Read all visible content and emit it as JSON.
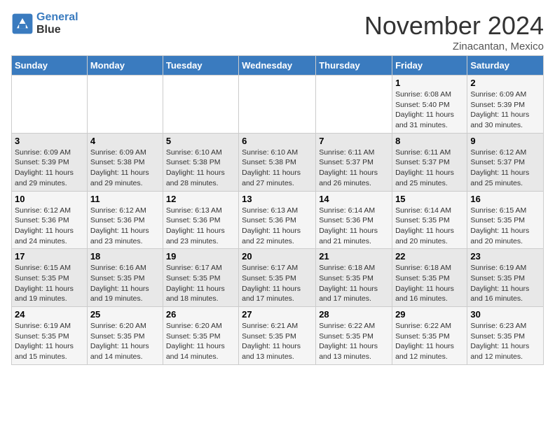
{
  "header": {
    "logo_line1": "General",
    "logo_line2": "Blue",
    "month_title": "November 2024",
    "subtitle": "Zinacantan, Mexico"
  },
  "weekdays": [
    "Sunday",
    "Monday",
    "Tuesday",
    "Wednesday",
    "Thursday",
    "Friday",
    "Saturday"
  ],
  "weeks": [
    [
      {
        "day": "",
        "info": ""
      },
      {
        "day": "",
        "info": ""
      },
      {
        "day": "",
        "info": ""
      },
      {
        "day": "",
        "info": ""
      },
      {
        "day": "",
        "info": ""
      },
      {
        "day": "1",
        "info": "Sunrise: 6:08 AM\nSunset: 5:40 PM\nDaylight: 11 hours and 31 minutes."
      },
      {
        "day": "2",
        "info": "Sunrise: 6:09 AM\nSunset: 5:39 PM\nDaylight: 11 hours and 30 minutes."
      }
    ],
    [
      {
        "day": "3",
        "info": "Sunrise: 6:09 AM\nSunset: 5:39 PM\nDaylight: 11 hours and 29 minutes."
      },
      {
        "day": "4",
        "info": "Sunrise: 6:09 AM\nSunset: 5:38 PM\nDaylight: 11 hours and 29 minutes."
      },
      {
        "day": "5",
        "info": "Sunrise: 6:10 AM\nSunset: 5:38 PM\nDaylight: 11 hours and 28 minutes."
      },
      {
        "day": "6",
        "info": "Sunrise: 6:10 AM\nSunset: 5:38 PM\nDaylight: 11 hours and 27 minutes."
      },
      {
        "day": "7",
        "info": "Sunrise: 6:11 AM\nSunset: 5:37 PM\nDaylight: 11 hours and 26 minutes."
      },
      {
        "day": "8",
        "info": "Sunrise: 6:11 AM\nSunset: 5:37 PM\nDaylight: 11 hours and 25 minutes."
      },
      {
        "day": "9",
        "info": "Sunrise: 6:12 AM\nSunset: 5:37 PM\nDaylight: 11 hours and 25 minutes."
      }
    ],
    [
      {
        "day": "10",
        "info": "Sunrise: 6:12 AM\nSunset: 5:36 PM\nDaylight: 11 hours and 24 minutes."
      },
      {
        "day": "11",
        "info": "Sunrise: 6:12 AM\nSunset: 5:36 PM\nDaylight: 11 hours and 23 minutes."
      },
      {
        "day": "12",
        "info": "Sunrise: 6:13 AM\nSunset: 5:36 PM\nDaylight: 11 hours and 23 minutes."
      },
      {
        "day": "13",
        "info": "Sunrise: 6:13 AM\nSunset: 5:36 PM\nDaylight: 11 hours and 22 minutes."
      },
      {
        "day": "14",
        "info": "Sunrise: 6:14 AM\nSunset: 5:36 PM\nDaylight: 11 hours and 21 minutes."
      },
      {
        "day": "15",
        "info": "Sunrise: 6:14 AM\nSunset: 5:35 PM\nDaylight: 11 hours and 20 minutes."
      },
      {
        "day": "16",
        "info": "Sunrise: 6:15 AM\nSunset: 5:35 PM\nDaylight: 11 hours and 20 minutes."
      }
    ],
    [
      {
        "day": "17",
        "info": "Sunrise: 6:15 AM\nSunset: 5:35 PM\nDaylight: 11 hours and 19 minutes."
      },
      {
        "day": "18",
        "info": "Sunrise: 6:16 AM\nSunset: 5:35 PM\nDaylight: 11 hours and 19 minutes."
      },
      {
        "day": "19",
        "info": "Sunrise: 6:17 AM\nSunset: 5:35 PM\nDaylight: 11 hours and 18 minutes."
      },
      {
        "day": "20",
        "info": "Sunrise: 6:17 AM\nSunset: 5:35 PM\nDaylight: 11 hours and 17 minutes."
      },
      {
        "day": "21",
        "info": "Sunrise: 6:18 AM\nSunset: 5:35 PM\nDaylight: 11 hours and 17 minutes."
      },
      {
        "day": "22",
        "info": "Sunrise: 6:18 AM\nSunset: 5:35 PM\nDaylight: 11 hours and 16 minutes."
      },
      {
        "day": "23",
        "info": "Sunrise: 6:19 AM\nSunset: 5:35 PM\nDaylight: 11 hours and 16 minutes."
      }
    ],
    [
      {
        "day": "24",
        "info": "Sunrise: 6:19 AM\nSunset: 5:35 PM\nDaylight: 11 hours and 15 minutes."
      },
      {
        "day": "25",
        "info": "Sunrise: 6:20 AM\nSunset: 5:35 PM\nDaylight: 11 hours and 14 minutes."
      },
      {
        "day": "26",
        "info": "Sunrise: 6:20 AM\nSunset: 5:35 PM\nDaylight: 11 hours and 14 minutes."
      },
      {
        "day": "27",
        "info": "Sunrise: 6:21 AM\nSunset: 5:35 PM\nDaylight: 11 hours and 13 minutes."
      },
      {
        "day": "28",
        "info": "Sunrise: 6:22 AM\nSunset: 5:35 PM\nDaylight: 11 hours and 13 minutes."
      },
      {
        "day": "29",
        "info": "Sunrise: 6:22 AM\nSunset: 5:35 PM\nDaylight: 11 hours and 12 minutes."
      },
      {
        "day": "30",
        "info": "Sunrise: 6:23 AM\nSunset: 5:35 PM\nDaylight: 11 hours and 12 minutes."
      }
    ]
  ]
}
